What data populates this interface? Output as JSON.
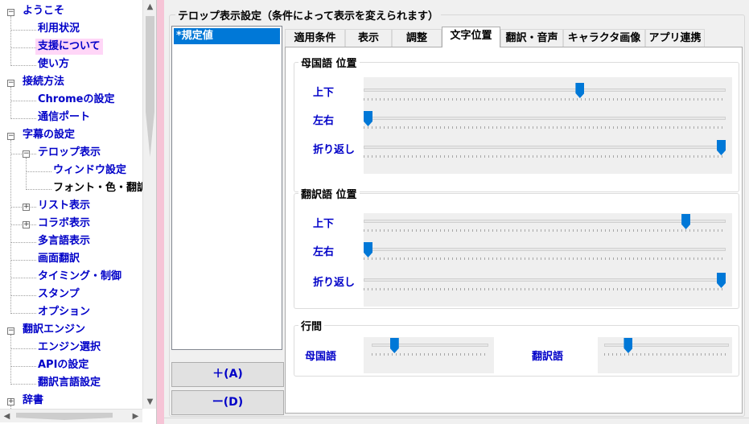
{
  "tree": {
    "items": [
      {
        "label": "ようこそ",
        "level": 0,
        "toggle": "−"
      },
      {
        "label": "利用状況",
        "level": 1
      },
      {
        "label": "支援について",
        "level": 1,
        "highlight": true
      },
      {
        "label": "使い方",
        "level": 1
      },
      {
        "label": "接続方法",
        "level": 0,
        "toggle": "−"
      },
      {
        "label": "Chromeの設定",
        "level": 1
      },
      {
        "label": "通信ポート",
        "level": 1
      },
      {
        "label": "字幕の設定",
        "level": 0,
        "toggle": "−"
      },
      {
        "label": "テロップ表示",
        "level": 1,
        "toggle": "−"
      },
      {
        "label": "ウィンドウ設定",
        "level": 2
      },
      {
        "label": "フォント・色・翻訳",
        "level": 2,
        "selected": true
      },
      {
        "label": "リスト表示",
        "level": 1,
        "toggle": "+"
      },
      {
        "label": "コラボ表示",
        "level": 1,
        "toggle": "+"
      },
      {
        "label": "多言語表示",
        "level": 1
      },
      {
        "label": "画面翻訳",
        "level": 1
      },
      {
        "label": "タイミング・制御",
        "level": 1
      },
      {
        "label": "スタンプ",
        "level": 1
      },
      {
        "label": "オプション",
        "level": 1
      },
      {
        "label": "翻訳エンジン",
        "level": 0,
        "toggle": "−"
      },
      {
        "label": "エンジン選択",
        "level": 1
      },
      {
        "label": "APIの設定",
        "level": 1
      },
      {
        "label": "翻訳言語設定",
        "level": 1
      },
      {
        "label": "辞書",
        "level": 0,
        "toggle": "+"
      }
    ]
  },
  "main": {
    "group_title": "テロップ表示設定（条件によって表示を変えられます）",
    "preset_list": {
      "items": [
        "*規定値"
      ]
    },
    "add_button": "＋(A)",
    "remove_button": "ー(D)",
    "tabs": [
      {
        "label": "適用条件"
      },
      {
        "label": "表示"
      },
      {
        "label": "調整"
      },
      {
        "label": "文字位置",
        "active": true
      },
      {
        "label": "翻訳・音声"
      },
      {
        "label": "キャラクタ画像"
      },
      {
        "label": "アプリ連携"
      }
    ],
    "native_group": {
      "title": "母国語  位置",
      "sliders": [
        {
          "label": "上下",
          "value": 0.6
        },
        {
          "label": "左右",
          "value": 0.0
        },
        {
          "label": "折り返し",
          "value": 1.0
        }
      ]
    },
    "translated_group": {
      "title": "翻訳語  位置",
      "sliders": [
        {
          "label": "上下",
          "value": 0.9
        },
        {
          "label": "左右",
          "value": 0.0
        },
        {
          "label": "折り返し",
          "value": 1.0
        }
      ]
    },
    "line_spacing_group": {
      "title": "行間",
      "native_label": "母国語",
      "native_value": 0.17,
      "translated_label": "翻訳語",
      "translated_value": 0.17
    }
  },
  "colors": {
    "accent": "#0078d7",
    "label_blue": "#0000c8",
    "highlight": "#ffd6f7",
    "pink_bar": "#f6c4d6"
  }
}
